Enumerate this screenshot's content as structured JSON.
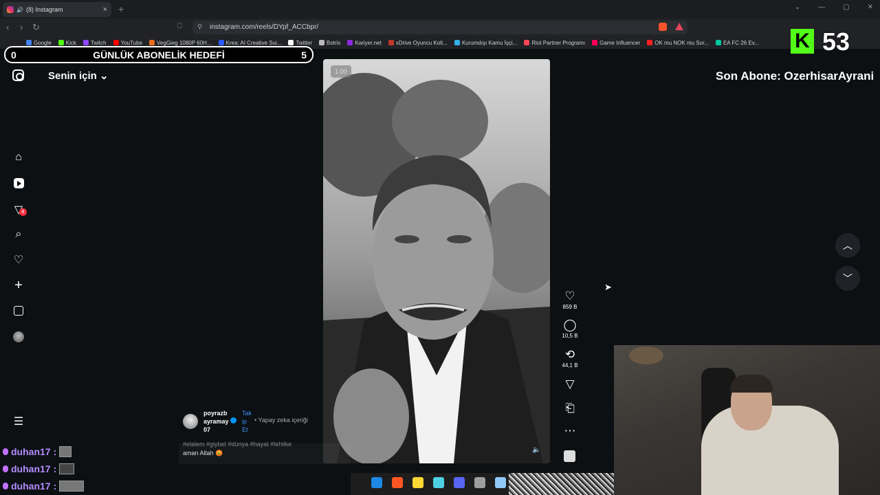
{
  "browser": {
    "tab_title": "(8) Instagram",
    "url": "instagram.com/reels/DYpf_ACCbpr/",
    "bookmarks": [
      "Google",
      "Kick",
      "Twitch",
      "YouTube",
      "VegGieg 1080P 60H...",
      "Krea: AI Creative Sui...",
      "Twitter",
      "Botrix",
      "Kariyer.net",
      "xDrive Oyuncu Kolt...",
      "Kurumdışı Kamu İşçi...",
      "Riot Partner Programı",
      "Game Influencer",
      "OK mu NOK mu Sor...",
      "EA FC 26 Ev..."
    ],
    "bookmark_colors": [
      "#4285f4",
      "#53fc18",
      "#9146ff",
      "#ff0000",
      "#e96c1f",
      "#2b5bff",
      "#ffffff",
      "#bbbbbb",
      "#8a2be2",
      "#c0392b",
      "#36b0e8",
      "#ff4655",
      "#ff0055",
      "#ff1f1f",
      "#00c8a0"
    ]
  },
  "overlay": {
    "goal_start": "0",
    "goal_title": "GÜNLÜK ABONELİK HEDEFİ",
    "goal_end": "5",
    "kick_letter": "K",
    "kick_count": "53",
    "last_sub": "Son Abone: OzerhisarAyrani"
  },
  "instagram": {
    "feed_label": "Senin için",
    "notification_count": "8",
    "speed": "1.00",
    "author": "poyrazb ayramay 07",
    "follow": "Tak ip Et",
    "ai_label": "• Yapay zeka içeriği",
    "hashtags": "#elalem #giybet #dünya #hayat #tehlike",
    "caption": "aman Allah 😡",
    "likes": "859 B",
    "comments": "10,5 B",
    "reposts": "44,1 B"
  },
  "chat": [
    {
      "user": "duhan17",
      "sep": ":"
    },
    {
      "user": "duhan17",
      "sep": ":"
    },
    {
      "user": "duhan17",
      "sep": ":"
    }
  ],
  "taskbar": {
    "icon_colors": [
      "#1e88e5",
      "#ff5722",
      "#fdd835",
      "#4dd0e1",
      "#5865f2",
      "#9e9e9e",
      "#90caf9"
    ]
  }
}
